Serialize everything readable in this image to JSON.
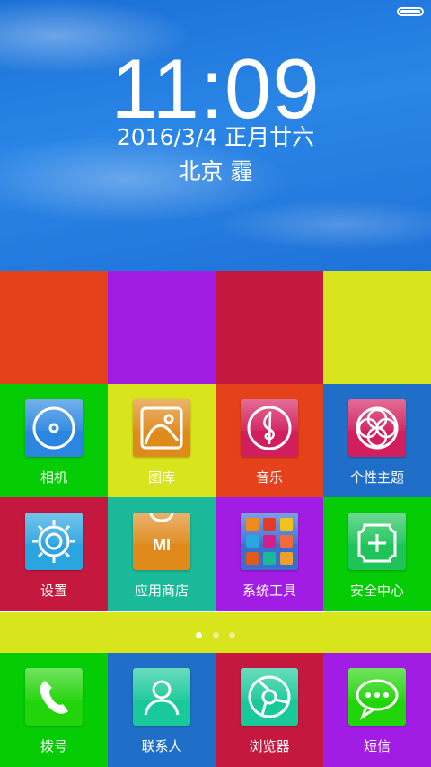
{
  "lockscreen": {
    "time": "11:09",
    "date": "2016/3/4  正月廿六",
    "weather": "北京  霾"
  },
  "colors": {
    "orange": "#e5411b",
    "purple": "#a21de4",
    "crimson": "#c4183f",
    "lime": "#d8e41c",
    "green": "#05cc04",
    "blue": "#1f6ec8",
    "teal": "#19b99a"
  },
  "apps": {
    "camera": {
      "label": "相机",
      "icon": "camera-icon"
    },
    "gallery": {
      "label": "图库",
      "icon": "gallery-icon"
    },
    "music": {
      "label": "音乐",
      "icon": "music-icon"
    },
    "themes": {
      "label": "个性主题",
      "icon": "themes-icon"
    },
    "settings": {
      "label": "设置",
      "icon": "gear-icon"
    },
    "app_store": {
      "label": "应用商店",
      "icon": "mi-store-icon",
      "icon_text": "MI"
    },
    "system_tools": {
      "label": "系统工具",
      "icon": "tools-folder-icon"
    },
    "security": {
      "label": "安全中心",
      "icon": "shield-plus-icon"
    }
  },
  "pager": {
    "pages": 3,
    "current": 1
  },
  "dock": {
    "phone": {
      "label": "拨号",
      "icon": "phone-icon"
    },
    "contacts": {
      "label": "联系人",
      "icon": "person-icon"
    },
    "browser": {
      "label": "浏览器",
      "icon": "browser-icon"
    },
    "messages": {
      "label": "短信",
      "icon": "message-icon"
    }
  }
}
